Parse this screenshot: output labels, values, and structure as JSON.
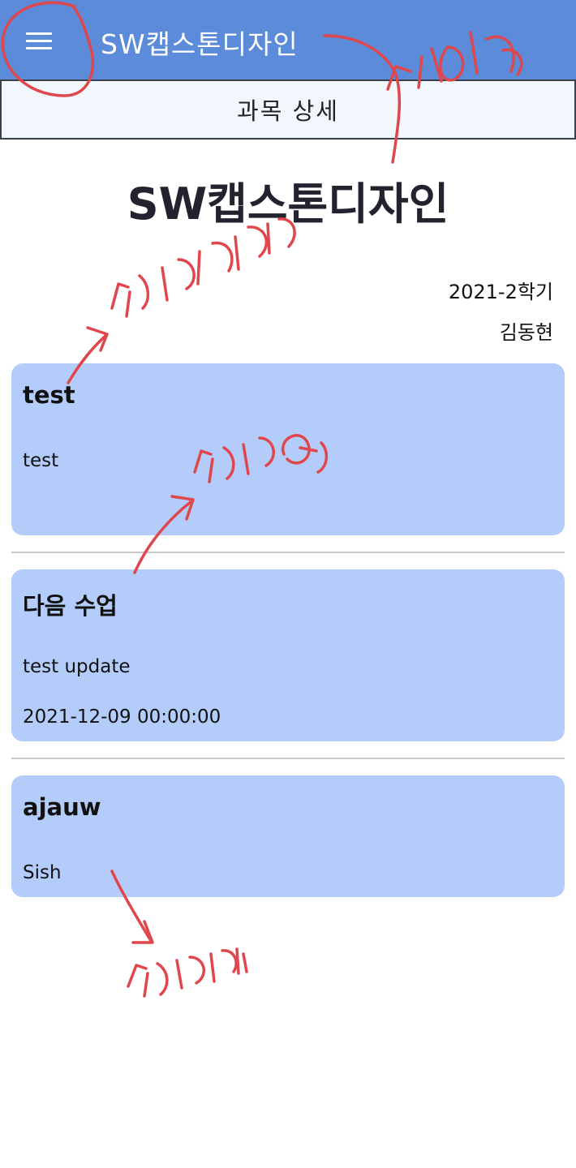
{
  "appbar": {
    "title": "SW캡스톤디자인",
    "menu_icon": "hamburger-menu-icon",
    "color": "#5b8bd9"
  },
  "subheader": {
    "title": "과목 상세"
  },
  "course": {
    "title": "SW캡스톤디자인",
    "term": "2021-2학기",
    "professor": "김동현"
  },
  "latest_notice": {
    "title": "test",
    "content": "test"
  },
  "next_class": {
    "title": "다음 수업",
    "description": "test update",
    "datetime": "2021-12-09 00:00:00"
  },
  "latest_assignment": {
    "title": "ajauw",
    "content": "Sish"
  },
  "colors": {
    "card": "#b3ccfa",
    "annotation": "#e0474c"
  }
}
